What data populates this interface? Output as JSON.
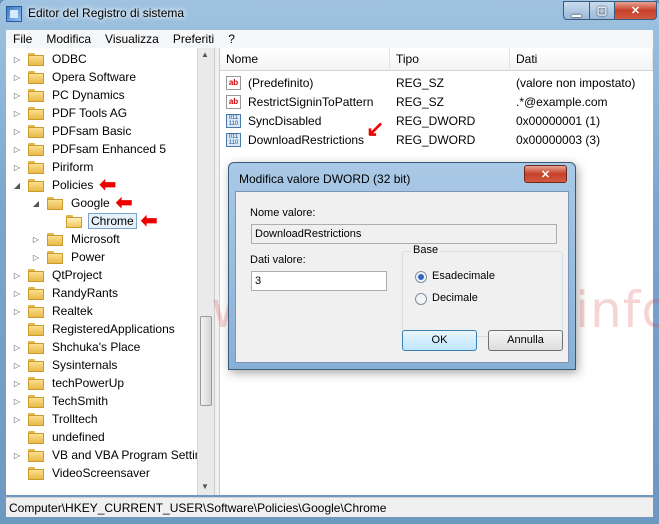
{
  "window": {
    "title": "Editor del Registro di sistema",
    "btn_min": "▁",
    "btn_max": "▢",
    "btn_close": "✕"
  },
  "menu": [
    "File",
    "Modifica",
    "Visualizza",
    "Preferiti",
    "?"
  ],
  "tree": [
    {
      "label": "ODBC",
      "expander": "▷",
      "indent": 0
    },
    {
      "label": "Opera Software",
      "expander": "▷",
      "indent": 0
    },
    {
      "label": "PC Dynamics",
      "expander": "▷",
      "indent": 0
    },
    {
      "label": "PDF Tools AG",
      "expander": "▷",
      "indent": 0
    },
    {
      "label": "PDFsam Basic",
      "expander": "▷",
      "indent": 0
    },
    {
      "label": "PDFsam Enhanced 5",
      "expander": "▷",
      "indent": 0
    },
    {
      "label": "Piriform",
      "expander": "▷",
      "indent": 0
    },
    {
      "label": "Policies",
      "expander": "◢",
      "indent": 0,
      "arrow": true
    },
    {
      "label": "Google",
      "expander": "◢",
      "indent": 1,
      "arrow": true
    },
    {
      "label": "Chrome",
      "expander": "",
      "indent": 2,
      "arrow": true,
      "selected": true,
      "open": true
    },
    {
      "label": "Microsoft",
      "expander": "▷",
      "indent": 1
    },
    {
      "label": "Power",
      "expander": "▷",
      "indent": 1
    },
    {
      "label": "QtProject",
      "expander": "▷",
      "indent": 0
    },
    {
      "label": "RandyRants",
      "expander": "▷",
      "indent": 0
    },
    {
      "label": "Realtek",
      "expander": "▷",
      "indent": 0
    },
    {
      "label": "RegisteredApplications",
      "expander": "",
      "indent": 0
    },
    {
      "label": "Shchuka's Place",
      "expander": "▷",
      "indent": 0
    },
    {
      "label": "Sysinternals",
      "expander": "▷",
      "indent": 0
    },
    {
      "label": "techPowerUp",
      "expander": "▷",
      "indent": 0
    },
    {
      "label": "TechSmith",
      "expander": "▷",
      "indent": 0
    },
    {
      "label": "Trolltech",
      "expander": "▷",
      "indent": 0
    },
    {
      "label": "undefined",
      "expander": "",
      "indent": 0
    },
    {
      "label": "VB and VBA Program Settings",
      "expander": "▷",
      "indent": 0
    },
    {
      "label": "VideoScreensaver",
      "expander": "",
      "indent": 0
    }
  ],
  "arrow_glyph": "⬅",
  "list": {
    "headers": [
      "Nome",
      "Tipo",
      "Dati"
    ],
    "rows": [
      {
        "icon": "string-value-icon",
        "glyph": "ab",
        "name": "(Predefinito)",
        "type": "REG_SZ",
        "data": "(valore non impostato)"
      },
      {
        "icon": "string-value-icon",
        "glyph": "ab",
        "name": "RestrictSigninToPattern",
        "type": "REG_SZ",
        "data": ".*@example.com"
      },
      {
        "icon": "dword-value-icon",
        "glyph": "011 110",
        "name": "SyncDisabled",
        "type": "REG_DWORD",
        "data": "0x00000001 (1)"
      },
      {
        "icon": "dword-value-icon",
        "glyph": "011 110",
        "name": "DownloadRestrictions",
        "type": "REG_DWORD",
        "data": "0x00000003 (3)",
        "arrow": "↙"
      }
    ]
  },
  "watermark": "www.guidami.info",
  "dialog": {
    "title": "Modifica valore DWORD (32 bit)",
    "close": "✕",
    "name_label": "Nome valore:",
    "name_value": "DownloadRestrictions",
    "data_label": "Dati valore:",
    "data_value": "3",
    "base_label": "Base",
    "radio_hex": "Esadecimale",
    "radio_dec": "Decimale",
    "ok": "OK",
    "cancel": "Annulla"
  },
  "status": "Computer\\HKEY_CURRENT_USER\\Software\\Policies\\Google\\Chrome"
}
